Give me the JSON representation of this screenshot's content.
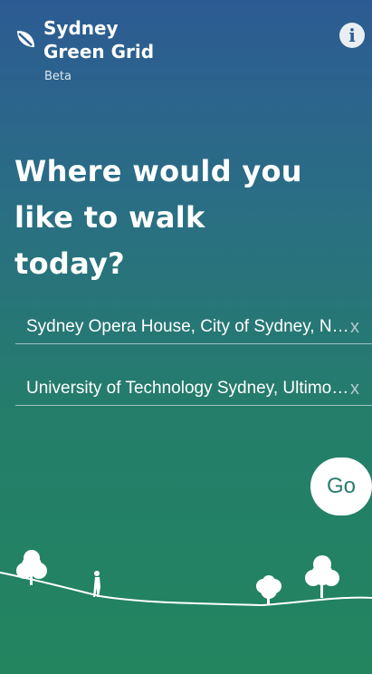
{
  "app": {
    "title": "Sydney\nGreen Grid",
    "subtitle": "Beta",
    "info_icon": "info-icon",
    "logo_icon": "leaf-icon"
  },
  "headline": "Where would you like to walk today?",
  "route": {
    "origin": "Sydney Opera House, City of Sydney, New South Wales, Australia",
    "destination": "University of Technology Sydney, Ultimo, New South Wales, Australia",
    "clear_label": "x"
  },
  "go_label": "Go",
  "colors": {
    "gradient_top": "#2c5b93",
    "gradient_bottom": "#22855f",
    "accent": "#2a7c6c"
  }
}
